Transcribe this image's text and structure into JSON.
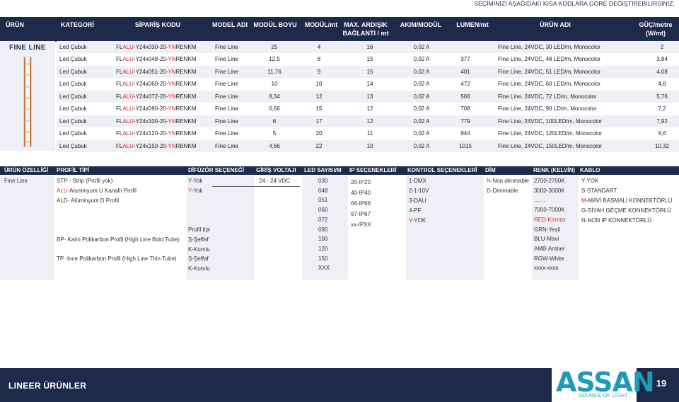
{
  "top_note": "SEÇİMİNİZİ AŞAĞIDAKİ KISA KODLARA GÖRE DEĞİŞTİREBİLİRSİNİZ.",
  "series_label": "FINE LINE",
  "main_headers": {
    "urun": "ÜRÜN",
    "kategori": "KATEGORİ",
    "siparis_kodu": "SİPARİŞ KODU",
    "model_adi": "MODEL ADI",
    "modul_boyu": "MODÜL BOYU",
    "modul_mt": "MODÜL/mt",
    "max_ardisik": "MAX. ARDIŞIK",
    "max_ardisik_2": "BAĞLANTI / mt",
    "akim_modul": "AKIM/MODÜL",
    "lumen_mt": "LUMEN/mt",
    "urun_adi": "ÜRÜN ADI",
    "guc_metre": "GÜÇ/metre",
    "guc_unit": "(W/mt)"
  },
  "products": [
    {
      "kategori": "Led Çubuk",
      "code_a": "FL",
      "code_b": "ALU",
      "code_c": "-Y24x030-20-",
      "code_d": "YN",
      "code_e": "RENKM",
      "model": "Fine Line",
      "boy": "25",
      "modul": "4",
      "max": "16",
      "akim": "0,02 A",
      "lumen": "",
      "ad": "Fine Line, 24VDC, 30 LED/m, Monocolor",
      "guc": "2"
    },
    {
      "kategori": "Led Çubuk",
      "code_a": "FL",
      "code_b": "ALU",
      "code_c": "-Y24x048-20-",
      "code_d": "YN",
      "code_e": "RENKM",
      "model": "Fine Line",
      "boy": "12,5",
      "modul": "8",
      "max": "15",
      "akim": "0,02 A",
      "lumen": "377",
      "ad": "Fine Line, 24VDC, 48 LED/m, Monocolor",
      "guc": "3,84"
    },
    {
      "kategori": "Led Çubuk",
      "code_a": "FL",
      "code_b": "ALU",
      "code_c": "-Y24x051-20-",
      "code_d": "YN",
      "code_e": "RENKM",
      "model": "Fine Line",
      "boy": "11,76",
      "modul": "9",
      "max": "15",
      "akim": "0,02 A",
      "lumen": "401",
      "ad": "Fine Line, 24VDC, 51 LED/m, Monocolor",
      "guc": "4,08"
    },
    {
      "kategori": "Led Çubuk",
      "code_a": "FL",
      "code_b": "ALU",
      "code_c": "-Y24x060-20-",
      "code_d": "YN",
      "code_e": "RENKM",
      "model": "Fine Line",
      "boy": "10",
      "modul": "10",
      "max": "14",
      "akim": "0,02 A",
      "lumen": "472",
      "ad": "Fine Line, 24VDC, 60 LED/m, Monocolor",
      "guc": "4,8"
    },
    {
      "kategori": "Led Çubuk",
      "code_a": "FL",
      "code_b": "ALU",
      "code_c": "-Y24x072-20-",
      "code_d": "YN",
      "code_e": "RENKM",
      "model": "Fine Line",
      "boy": "8,34",
      "modul": "12",
      "max": "13",
      "akim": "0,02 A",
      "lumen": "566",
      "ad": "Fine Line, 24VDC, 72 LD/m, Monocolor",
      "guc": "5,76"
    },
    {
      "kategori": "Led Çubuk",
      "code_a": "FL",
      "code_b": "ALU",
      "code_c": "-Y24x090-20-",
      "code_d": "YN",
      "code_e": "RENKM",
      "model": "Fine Line",
      "boy": "6,66",
      "modul": "15",
      "max": "12",
      "akim": "0,02 A",
      "lumen": "708",
      "ad": "Fine Line, 24VDC, 90 LD/m, Monocolor",
      "guc": "7,2"
    },
    {
      "kategori": "Led Çubuk",
      "code_a": "FL",
      "code_b": "ALU",
      "code_c": "-Y24x100-20-",
      "code_d": "YN",
      "code_e": "RENKM",
      "model": "Fine Line",
      "boy": "6",
      "modul": "17",
      "max": "12",
      "akim": "0,02 A",
      "lumen": "779",
      "ad": "Fine Line, 24VDC, 100LED/m, Monocolor",
      "guc": "7,92"
    },
    {
      "kategori": "Led Çubuk",
      "code_a": "FL",
      "code_b": "ALU",
      "code_c": "-Y24x120-20-",
      "code_d": "YN",
      "code_e": "RENKM",
      "model": "Fine Line",
      "boy": "5",
      "modul": "20",
      "max": "11",
      "akim": "0,02 A",
      "lumen": "944",
      "ad": "Fine Line, 24VDC, 120LED/m, Monocolor",
      "guc": "9,6"
    },
    {
      "kategori": "Led Çubuk",
      "code_a": "FL",
      "code_b": "ALU",
      "code_c": "-Y24x150-20-",
      "code_d": "YN",
      "code_e": "RENKM",
      "model": "Fine Line",
      "boy": "4,66",
      "modul": "22",
      "max": "10",
      "akim": "0,02 A",
      "lumen": "1015",
      "ad": "Fine Line, 24VDC, 150LED/m, Monocolor",
      "guc": "10,32"
    }
  ],
  "option_headers": {
    "urun_ozelligi": "ÜRÜN ÖZELLİĞİ",
    "profil_tipi": "PROFİL TİPİ",
    "difuzor": "DİFÜZÖR SEÇENEĞİ",
    "giris_voltaji": "GİRİŞ VOLTAJI",
    "led_sayisi": "LED SAYISI/M",
    "ip": "IP SEÇENEKLERİ",
    "kontrol": "KONTROL SEÇENEKLERİ",
    "dim": "DİM",
    "renk": "RENK (KELVİN)",
    "kablo": "KABLO"
  },
  "options": {
    "urun_ozelligi": "Fine Line",
    "profil": {
      "stp": "STP - Strip (Profil yok)",
      "alu_code": "ALU",
      "alu_rest": "-Aluminyum U Kanallı Profil",
      "ald": "ALD- Alüminyum D Profil",
      "bp": "BP- Kalın Polikarbon Profil (High Line Bold Tube)",
      "tp": "TP -İnce Polikarbon Profil (High Line Thin Tube)"
    },
    "difuzor": {
      "y_yok": "Y-Yok",
      "y_code": "Y",
      "y_rest": "-Yok",
      "profil_tipi": "Profil tipi",
      "s_seffaf": "Ş-Şeffaf",
      "k_kumlu": "K-Kumlu",
      "s_seffaf_2": "Ş-Şeffaf",
      "k_kumlu_2": "K-Kumlu"
    },
    "giris_voltaji": "24 - 24 VDC",
    "led_sayisi": [
      "030",
      "048",
      "051",
      "060",
      "072",
      "090",
      "100",
      "120",
      "150",
      "XXX"
    ],
    "ip": [
      "20-IP20",
      "40-IP40",
      "66-IP66",
      "67-IP67",
      "xx-IPXX"
    ],
    "kontrol": {
      "dmx": "1-DMX",
      "v10": "2-1-10V",
      "dali": "3-DALI",
      "pf": "4-PF",
      "yok_code": "Y",
      "yok_rest": "-YOK"
    },
    "dim": {
      "n_code": "N",
      "n_rest": "-Non dimmable",
      "d": "D-Dimmable"
    },
    "renk": [
      "2700-2700K",
      "3000-3000K",
      "……",
      "7000-7000K",
      "RED-Kırmızı",
      "GRN-Yeşil",
      "BLU-Mavi",
      "AMB-Amber",
      "RGW-White",
      "xxxx-xxxx"
    ],
    "kablo": {
      "y_yok": "Y-YOK",
      "s_standart": "S-STANDART",
      "m_code": "M",
      "m_rest": "-MAVİ BASMALI KONNEKTÖRLÜ",
      "g": "G-SİYAH GEÇME KONNEKTÖRLÜ",
      "n": "N-NON IP KONNEKTÖRLÜ"
    }
  },
  "footer": {
    "title": "LINEER ÜRÜNLER",
    "logo": "ASSAN",
    "logo_sub": "SOURCE OF LIGHT",
    "page": "19"
  },
  "colors": {
    "header_navy": "#1e2a4a",
    "code_red": "#d7262b",
    "row_shade": "#eef0f6",
    "brand_teal": "#1f9bb9"
  }
}
